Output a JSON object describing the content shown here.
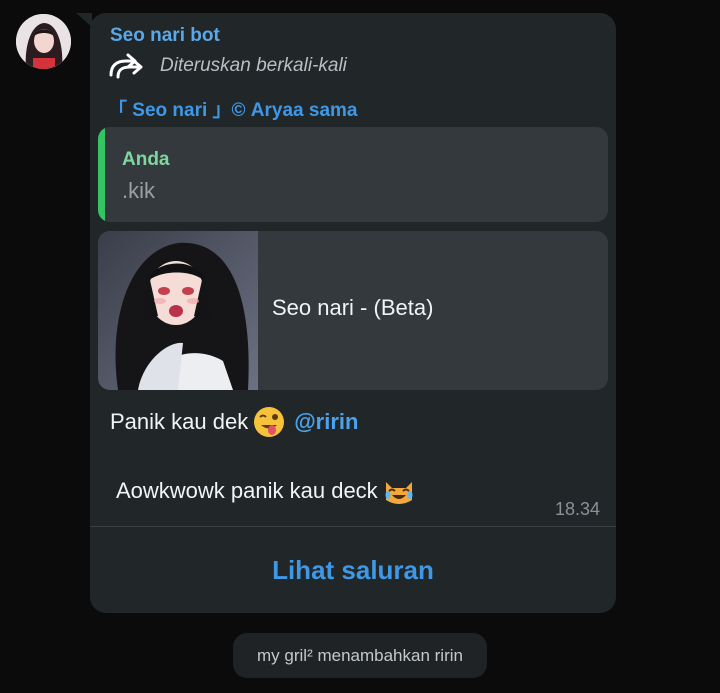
{
  "message": {
    "sender_name": "Seo nari bot",
    "forward_label": "Diteruskan berkali-kali",
    "channel_signature": "「 Seo nari 」© Aryaa sama",
    "reply": {
      "author": "Anda",
      "text": ".kik"
    },
    "link_preview": {
      "title": "Seo nari - (Beta)"
    },
    "line1_text": "Panik kau dek",
    "line1_emoji": "winking-face-with-tongue",
    "mention": "@ririn",
    "line2_text": "Aowkwowk panik kau deck",
    "line2_emoji": "cat-with-tears-of-joy",
    "time": "18.34",
    "view_channel_button": "Lihat saluran"
  },
  "service_message": "my gril² menambahkan ririn",
  "colors": {
    "background": "#0b0b0c",
    "bubble": "#212629",
    "card": "#34393d",
    "accent_blue": "#3e98e6",
    "sender_blue": "#5aa7ea",
    "reply_bar_green": "#34c463",
    "reply_name_green": "#7ed6a0"
  },
  "icons": {
    "forward": "forward-arrow-icon"
  }
}
